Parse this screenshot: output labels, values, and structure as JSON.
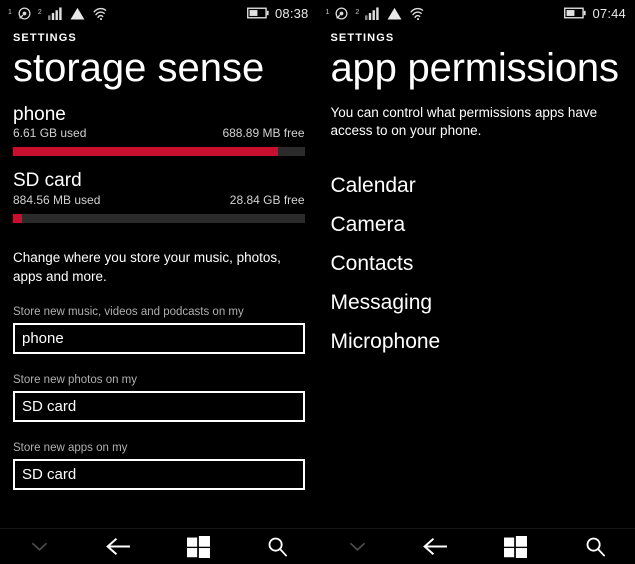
{
  "screens": [
    {
      "statusbar": {
        "ringer_sup": "1",
        "signal_sup": "2",
        "icons": [
          "vibrate-icon",
          "signal-bars-icon",
          "triangle-icon",
          "wifi-icon"
        ],
        "battery": "battery-half-icon",
        "clock": "08:38"
      },
      "header": {
        "label": "SETTINGS",
        "title": "storage sense"
      },
      "storage": [
        {
          "name": "phone",
          "used": "6.61 GB used",
          "free": "688.89 MB free",
          "percent_used": 91
        },
        {
          "name": "SD card",
          "used": "884.56 MB used",
          "free": "28.84 GB free",
          "percent_used": 3
        }
      ],
      "description": "Change where you store your music, photos, apps and more.",
      "fields": [
        {
          "label": "Store new music, videos and podcasts on my",
          "value": "phone"
        },
        {
          "label": "Store new photos on my",
          "value": "SD card"
        },
        {
          "label": "Store new apps on my",
          "value": "SD card"
        }
      ],
      "nav": [
        "chevron-down-icon",
        "back-arrow-icon",
        "windows-logo-icon",
        "search-icon"
      ]
    },
    {
      "statusbar": {
        "ringer_sup": "1",
        "signal_sup": "2",
        "icons": [
          "vibrate-icon",
          "signal-bars-icon",
          "triangle-icon",
          "wifi-icon"
        ],
        "battery": "battery-half-icon",
        "clock": "07:44"
      },
      "header": {
        "label": "SETTINGS",
        "title": "app permissions"
      },
      "intro": "You can control what permissions apps have access to on your phone.",
      "permissions": [
        "Calendar",
        "Camera",
        "Contacts",
        "Messaging",
        "Microphone"
      ],
      "nav": [
        "chevron-down-icon",
        "back-arrow-icon",
        "windows-logo-icon",
        "search-icon"
      ]
    }
  ],
  "colors": {
    "accent_red": "#c8102e",
    "background": "#000000",
    "track": "#2b2b2b",
    "label_gray": "#b0b0b0"
  }
}
